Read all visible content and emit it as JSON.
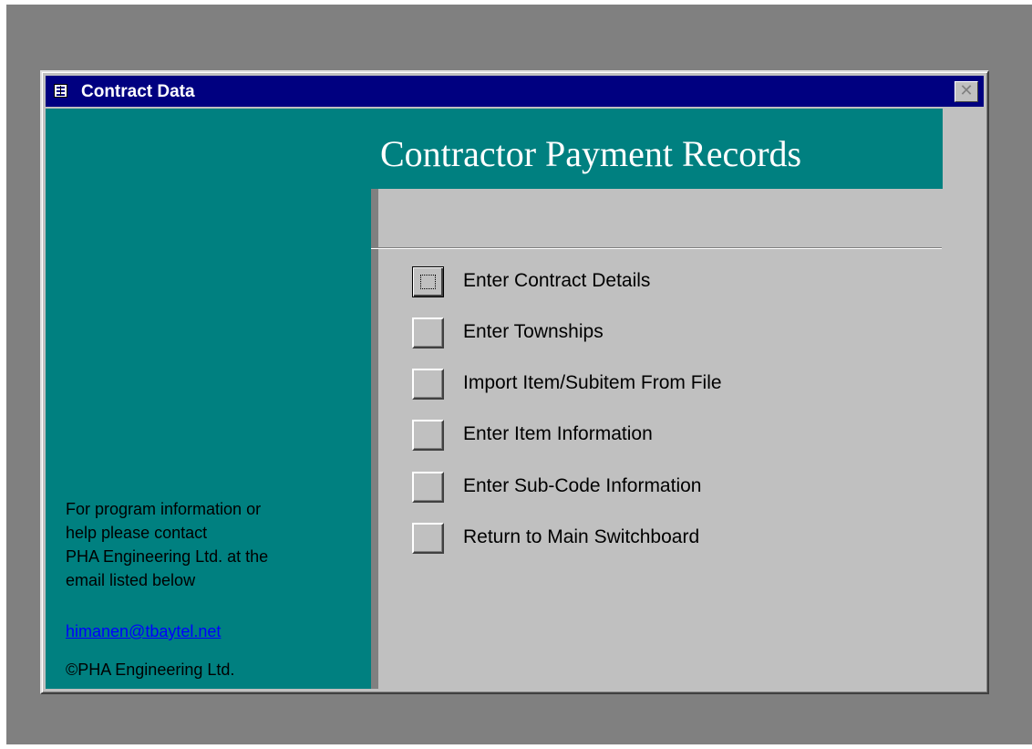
{
  "window": {
    "title": "Contract Data",
    "close_glyph": "✕"
  },
  "header": {
    "title": "Contractor Payment Records"
  },
  "menu": {
    "items": [
      {
        "label": "Enter Contract Details"
      },
      {
        "label": "Enter Townships"
      },
      {
        "label": "Import Item/Subitem From File"
      },
      {
        "label": "Enter Item Information"
      },
      {
        "label": "Enter Sub-Code Information"
      },
      {
        "label": "Return to Main Switchboard"
      }
    ]
  },
  "info": {
    "lines": [
      "For program information or",
      "help please contact",
      "PHA Engineering Ltd. at the",
      "email listed below"
    ],
    "email": "himanen@tbaytel.net",
    "copyright": "©PHA Engineering Ltd."
  },
  "colors": {
    "title_bar": "#000080",
    "panel_teal": "#008080",
    "face_gray": "#c0c0c0",
    "desktop_gray": "#808080",
    "link_blue": "#0000ff"
  },
  "icons": {
    "window": "form-icon",
    "close": "close-icon"
  }
}
